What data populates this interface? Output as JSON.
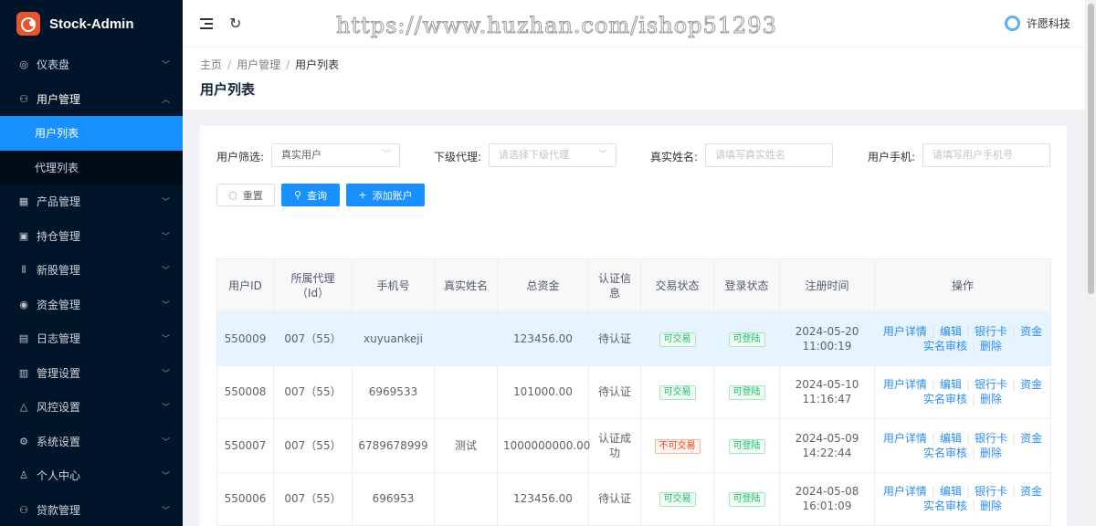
{
  "app": {
    "name": "Stock-Admin"
  },
  "watermark": "https://www.huzhan.com/ishop51293",
  "header": {
    "user_name": "许愿科技"
  },
  "sidebar": {
    "items": [
      {
        "label": "仪表盘",
        "icon": "dashboard-icon"
      },
      {
        "label": "用户管理",
        "icon": "user-manage-icon",
        "open": true,
        "children": [
          {
            "label": "用户列表",
            "active": true
          },
          {
            "label": "代理列表"
          }
        ]
      },
      {
        "label": "产品管理",
        "icon": "chart-icon"
      },
      {
        "label": "持仓管理",
        "icon": "position-icon"
      },
      {
        "label": "新股管理",
        "icon": "ipo-icon"
      },
      {
        "label": "资金管理",
        "icon": "money-icon"
      },
      {
        "label": "日志管理",
        "icon": "log-icon"
      },
      {
        "label": "管理设置",
        "icon": "admin-settings-icon"
      },
      {
        "label": "风控设置",
        "icon": "warning-icon"
      },
      {
        "label": "系统设置",
        "icon": "gear-icon"
      },
      {
        "label": "个人中心",
        "icon": "person-icon"
      },
      {
        "label": "贷款管理",
        "icon": "loan-icon"
      }
    ]
  },
  "breadcrumb": [
    "主页",
    "用户管理",
    "用户列表"
  ],
  "page_title": "用户列表",
  "filters": {
    "user_filter_label": "用户筛选:",
    "user_filter_value": "真实用户",
    "agent_label": "下级代理:",
    "agent_placeholder": "请选择下级代理",
    "real_name_label": "真实姓名:",
    "real_name_placeholder": "请填写真实姓名",
    "phone_label": "用户手机:",
    "phone_placeholder": "请填写用户手机号"
  },
  "buttons": {
    "reset": "重置",
    "search": "查询",
    "add": "添加账户"
  },
  "table": {
    "headers": [
      "用户ID",
      "所属代理（Id）",
      "手机号",
      "真实姓名",
      "总资金",
      "认证信息",
      "交易状态",
      "登录状态",
      "注册时间",
      "操作"
    ],
    "actions": [
      "用户详情",
      "编辑",
      "银行卡",
      "资金",
      "实名审核",
      "删除"
    ],
    "rows": [
      {
        "id": "550009",
        "agent": "007（55）",
        "phone": "xuyuankeji",
        "name": "",
        "funds": "123456.00",
        "auth": "待认证",
        "trade": "可交易",
        "trade_ok": true,
        "login": "可登陆",
        "date": "2024-05-20",
        "time": "11:00:19"
      },
      {
        "id": "550008",
        "agent": "007（55）",
        "phone": "6969533",
        "name": "",
        "funds": "101000.00",
        "auth": "待认证",
        "trade": "可交易",
        "trade_ok": true,
        "login": "可登陆",
        "date": "2024-05-10",
        "time": "11:16:47"
      },
      {
        "id": "550007",
        "agent": "007（55）",
        "phone": "6789678999",
        "name": "测试",
        "funds": "1000000000.00",
        "auth": "认证成功",
        "trade": "不可交易",
        "trade_ok": false,
        "login": "可登陆",
        "date": "2024-05-09",
        "time": "14:22:44"
      },
      {
        "id": "550006",
        "agent": "007（55）",
        "phone": "696953",
        "name": "",
        "funds": "123456.00",
        "auth": "待认证",
        "trade": "可交易",
        "trade_ok": true,
        "login": "可登陆",
        "date": "2024-05-08",
        "time": "16:01:09"
      }
    ]
  },
  "colors": {
    "sidebar_bg": "#001529",
    "accent": "#1890ff",
    "link": "#2d8cf0",
    "success": "#19be6b",
    "danger": "#ed4014"
  }
}
